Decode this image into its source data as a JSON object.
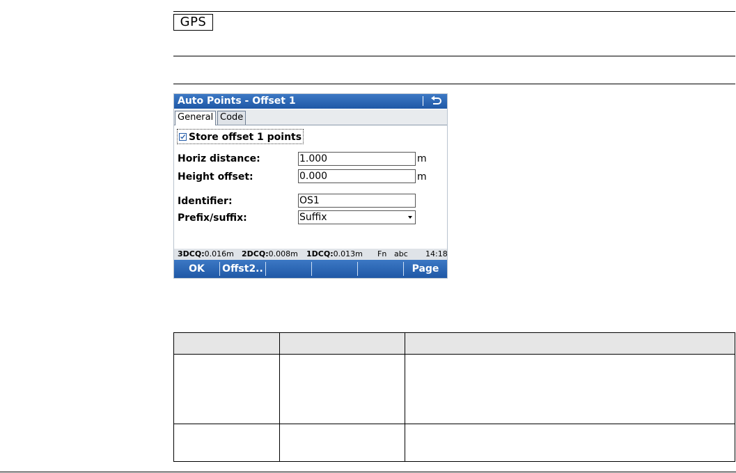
{
  "header": {
    "tag": "GPS"
  },
  "screen": {
    "title": "Auto Points - Offset 1",
    "tabs": [
      {
        "label": "General",
        "active": true
      },
      {
        "label": "Code",
        "active": false
      }
    ],
    "store_checkbox": {
      "label": "Store offset 1 points",
      "checked": true
    },
    "fields": {
      "horiz_distance": {
        "label": "Horiz distance:",
        "value": "1.000",
        "unit": "m"
      },
      "height_offset": {
        "label": "Height offset:",
        "value": "0.000",
        "unit": "m"
      },
      "identifier": {
        "label": "Identifier:",
        "value": "OS1"
      },
      "prefix_suffix": {
        "label": "Prefix/suffix:",
        "value": "Suffix"
      }
    },
    "status": {
      "q3_label": "3DCQ:",
      "q3_value": "0.016m",
      "q2_label": "2DCQ:",
      "q2_value": "0.008m",
      "q1_label": "1DCQ:",
      "q1_value": "0.013m",
      "fn": "Fn",
      "input_mode": "abc",
      "time": "14:18"
    },
    "softkeys": [
      "OK",
      "Offst2..",
      "",
      "",
      "",
      "Page"
    ]
  },
  "colors": {
    "titlebar": "#1f58a6",
    "table_header": "#e6e6e6"
  },
  "icons": {
    "back": "back-arrow-icon",
    "checkbox": "checkbox-checked-icon",
    "dropdown": "dropdown-arrow-icon"
  }
}
